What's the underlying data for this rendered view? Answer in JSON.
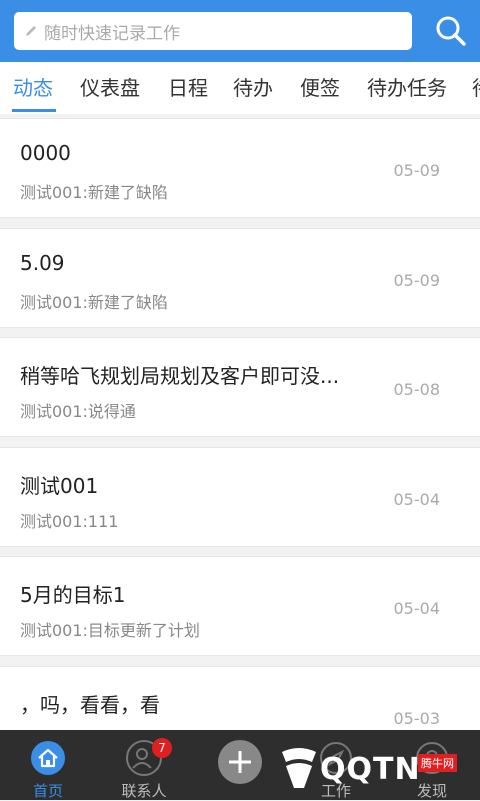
{
  "search": {
    "placeholder": "随时快速记录工作"
  },
  "tabs": [
    {
      "label": "动态",
      "active": true
    },
    {
      "label": "仪表盘"
    },
    {
      "label": "日程"
    },
    {
      "label": "待办"
    },
    {
      "label": "便签"
    },
    {
      "label": "待办任务"
    },
    {
      "label": "待"
    }
  ],
  "feed": [
    {
      "title": "0000",
      "subtitle": "测试001:新建了缺陷",
      "date": "05-09"
    },
    {
      "title": "5.09",
      "subtitle": "测试001:新建了缺陷",
      "date": "05-09"
    },
    {
      "title": "稍等哈飞规划局规划及客户即可没...",
      "subtitle": "测试001:说得通",
      "date": "05-08"
    },
    {
      "title": "测试001",
      "subtitle": "测试001:111",
      "date": "05-04"
    },
    {
      "title": "5月的目标1",
      "subtitle": "测试001:目标更新了计划",
      "date": "05-04"
    },
    {
      "title": "，吗，看看，看",
      "subtitle": "",
      "date": "05-03"
    }
  ],
  "bottom_nav": [
    {
      "label": "首页",
      "icon": "home-icon",
      "active": true
    },
    {
      "label": "联系人",
      "icon": "contacts-icon",
      "badge": "7"
    },
    {
      "label": "",
      "icon": "add-icon"
    },
    {
      "label": "工作",
      "icon": "compass-icon"
    },
    {
      "label": "发现",
      "icon": "discover-icon"
    }
  ],
  "watermark": {
    "logo": "QQTN",
    "tag": "腾牛网"
  },
  "colors": {
    "primary": "#3a8ee6",
    "nav_bg": "#2e2e2e",
    "badge": "#e02020"
  }
}
